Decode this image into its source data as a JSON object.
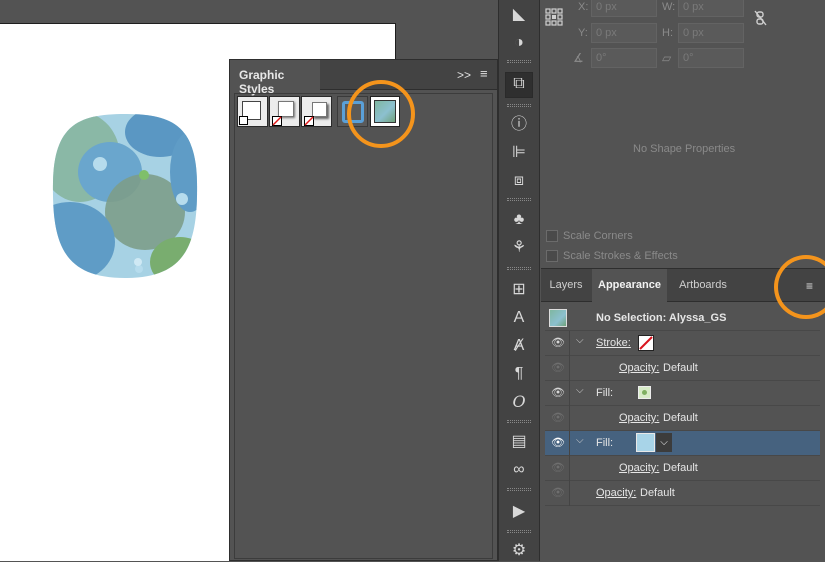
{
  "graphic_styles_panel": {
    "title": "Graphic Styles",
    "expand_glyph": ">>",
    "menu_glyph": "≡"
  },
  "transform_panel": {
    "x_label": "X:",
    "x_value": "0 px",
    "y_label": "Y:",
    "y_value": "0 px",
    "w_label": "W:",
    "w_value": "0 px",
    "h_label": "H:",
    "h_value": "0 px",
    "angle_value": "0°",
    "shear_value": "0°",
    "no_shape_text": "No Shape Properties",
    "scale_corners": "Scale Corners",
    "scale_strokes": "Scale Strokes & Effects"
  },
  "appearance_panel": {
    "tabs": [
      "Layers",
      "Appearance",
      "Artboards"
    ],
    "active_tab": "Appearance",
    "header": "No Selection: Alyssa_GS",
    "rows": [
      {
        "label": "Stroke:",
        "type": "stroke"
      },
      {
        "label": "Opacity:",
        "value": "Default"
      },
      {
        "label": "Fill:",
        "type": "fill-pattern"
      },
      {
        "label": "Opacity:",
        "value": "Default"
      },
      {
        "label": "Fill:",
        "type": "fill-solid"
      },
      {
        "label": "Opacity:",
        "value": "Default"
      },
      {
        "label": "Opacity:",
        "value": "Default"
      }
    ]
  },
  "colors": {
    "highlight": "#f4941c",
    "selected_row": "#46627f",
    "fill_swatch": "#a8d4e8",
    "panel_bg": "#535353"
  }
}
